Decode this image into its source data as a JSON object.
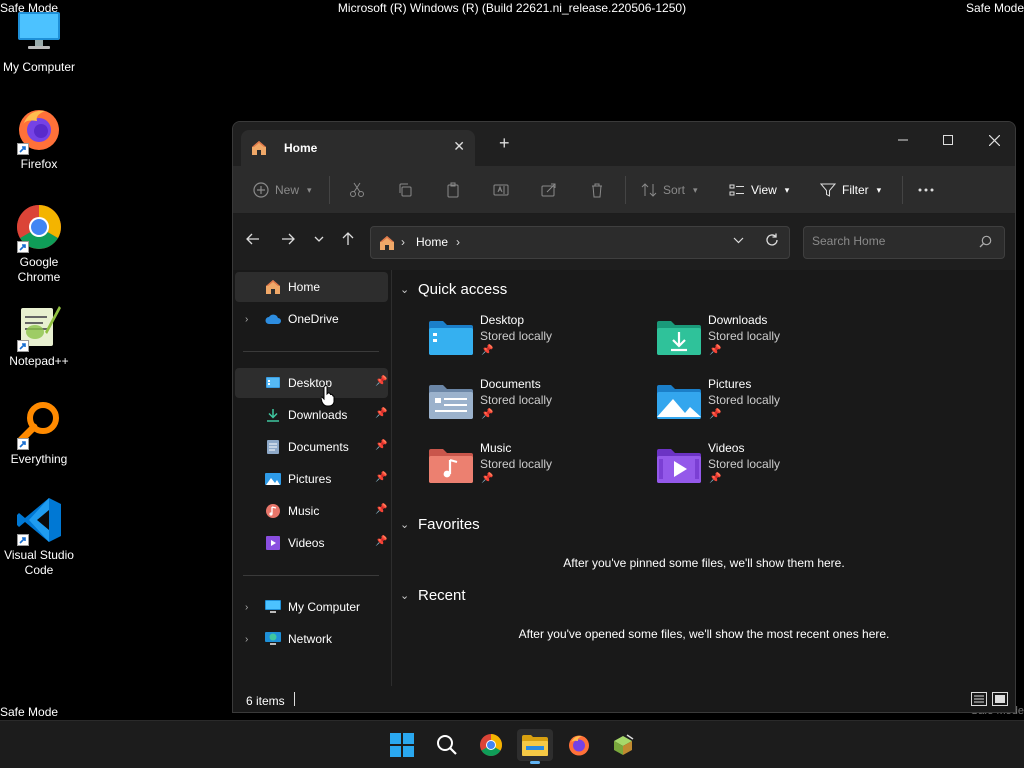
{
  "system": {
    "safe_mode": "Safe Mode",
    "build": "Microsoft (R) Windows (R) (Build 22621.ni_release.220506-1250)"
  },
  "desktop": {
    "icons": [
      {
        "label": "My Computer",
        "icon": "monitor-icon"
      },
      {
        "label": "Firefox",
        "icon": "firefox-icon"
      },
      {
        "label": "Google Chrome",
        "icon": "chrome-icon"
      },
      {
        "label": "Notepad++",
        "icon": "notepadpp-icon"
      },
      {
        "label": "Everything",
        "icon": "everything-search-icon"
      },
      {
        "label": "Visual Studio Code",
        "icon": "vscode-icon"
      }
    ]
  },
  "explorer": {
    "tab": {
      "title": "Home",
      "icon": "home-icon"
    },
    "toolbar": {
      "new_label": "New",
      "sort_label": "Sort",
      "view_label": "View",
      "filter_label": "Filter"
    },
    "address": {
      "location": "Home"
    },
    "search": {
      "placeholder": "Search Home"
    },
    "sidebar": {
      "home": "Home",
      "onedrive": "OneDrive",
      "pinned": [
        {
          "label": "Desktop",
          "icon": "desktop-folder-icon"
        },
        {
          "label": "Downloads",
          "icon": "download-icon"
        },
        {
          "label": "Documents",
          "icon": "documents-icon"
        },
        {
          "label": "Pictures",
          "icon": "pictures-icon"
        },
        {
          "label": "Music",
          "icon": "music-icon"
        },
        {
          "label": "Videos",
          "icon": "videos-icon"
        }
      ],
      "my_computer": "My Computer",
      "network": "Network"
    },
    "main": {
      "quick_access_title": "Quick access",
      "quick_access": [
        {
          "name": "Desktop",
          "sub": "Stored locally"
        },
        {
          "name": "Downloads",
          "sub": "Stored locally"
        },
        {
          "name": "Documents",
          "sub": "Stored locally"
        },
        {
          "name": "Pictures",
          "sub": "Stored locally"
        },
        {
          "name": "Music",
          "sub": "Stored locally"
        },
        {
          "name": "Videos",
          "sub": "Stored locally"
        }
      ],
      "favorites_title": "Favorites",
      "favorites_empty": "After you've pinned some files, we'll show them here.",
      "recent_title": "Recent",
      "recent_empty": "After you've opened some files, we'll show the most recent ones here."
    },
    "status": {
      "count": "6 items"
    }
  },
  "taskbar": {
    "items": [
      "start-icon",
      "search-icon",
      "chrome-icon",
      "file-explorer-icon",
      "firefox-icon",
      "notepadpp-icon"
    ],
    "active": "file-explorer-icon"
  },
  "colors": {
    "window_bg": "#191919",
    "toolbar_bg": "#2c2c2c",
    "accent": "#5fb2f2",
    "folder_yellow": "#f0c04a"
  }
}
